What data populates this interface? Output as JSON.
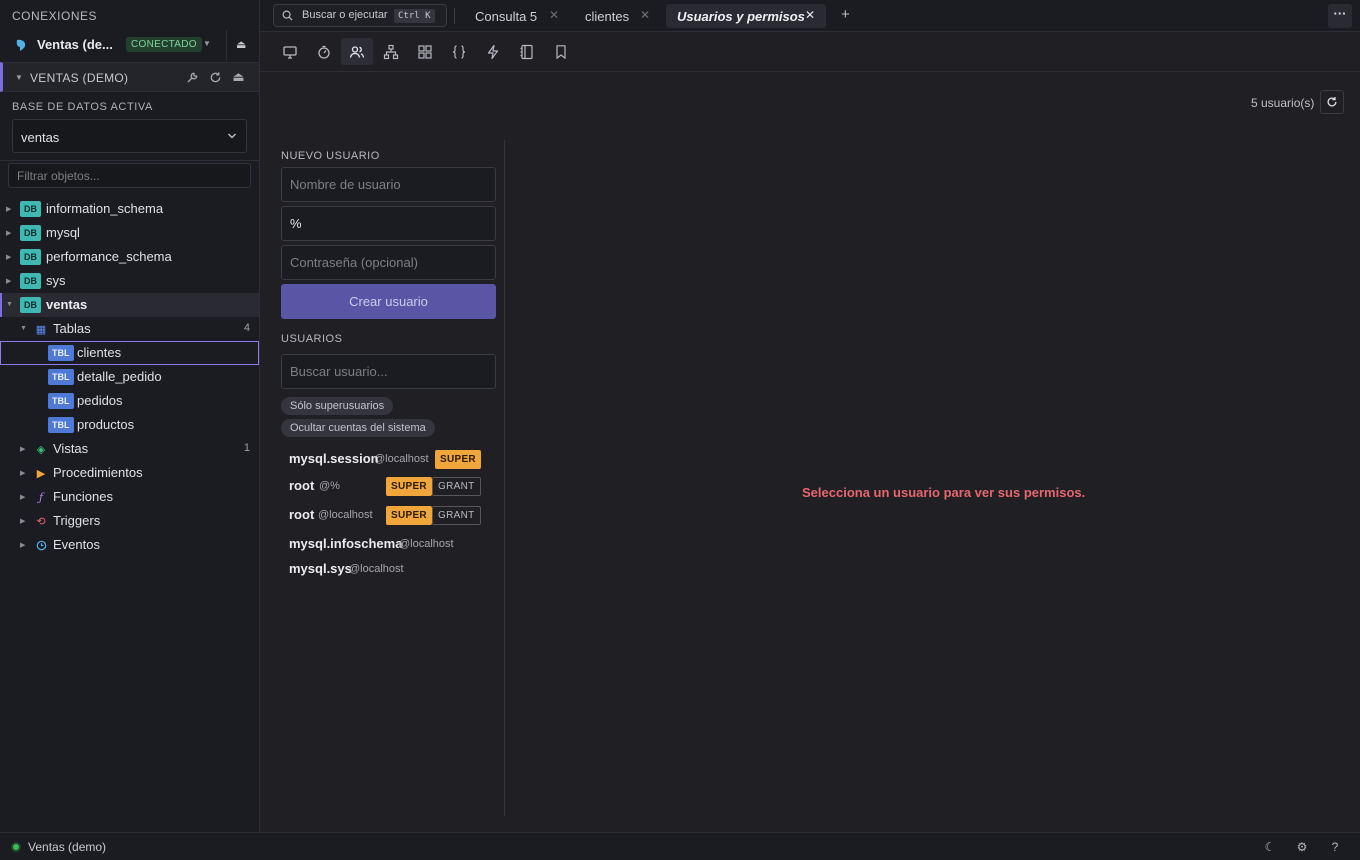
{
  "sidebar": {
    "title": "CONEXIONES",
    "connection": {
      "name": "Ventas (de...",
      "status": "CONECTADO"
    },
    "db_header": {
      "name": "VENTAS (DEMO)"
    },
    "active_db": {
      "label": "BASE DE DATOS ACTIVA",
      "value": "ventas"
    },
    "filter": {
      "placeholder": "Filtrar objetos..."
    },
    "tree": {
      "databases": [
        "information_schema",
        "mysql",
        "performance_schema",
        "sys",
        "ventas"
      ],
      "db_badge": "DB",
      "tbl_badge": "TBL",
      "tablas": {
        "label": "Tablas",
        "count": "4"
      },
      "tables": [
        "clientes",
        "detalle_pedido",
        "pedidos",
        "productos"
      ],
      "vistas": {
        "label": "Vistas",
        "count": "1"
      },
      "procedimientos": "Procedimientos",
      "funciones": "Funciones",
      "triggers": "Triggers",
      "eventos": "Eventos"
    }
  },
  "topbar": {
    "search": {
      "label": "Buscar o ejecutar",
      "shortcut": "Ctrl K"
    },
    "tabs": [
      {
        "label": "Consulta 5",
        "active": false
      },
      {
        "label": "clientes",
        "active": false
      },
      {
        "label": "Usuarios y permisos",
        "active": true
      }
    ],
    "add_tab": "+",
    "more": "···"
  },
  "toolbar": {
    "buttons": [
      "monitor-icon",
      "timer-icon",
      "users-icon",
      "hierarchy-icon",
      "grid-icon",
      "braces-icon",
      "bolt-icon",
      "notebook-icon",
      "bookmark-icon"
    ],
    "active": "users-icon"
  },
  "main": {
    "user_count": "5 usuario(s)",
    "new_user": {
      "label": "NUEVO USUARIO",
      "username_placeholder": "Nombre de usuario",
      "host_value": "%",
      "password_placeholder": "Contraseña (opcional)",
      "create_label": "Crear usuario"
    },
    "users": {
      "label": "USUARIOS",
      "search_placeholder": "Buscar usuario...",
      "filter_super": "Sólo superusuarios",
      "filter_system": "Ocultar cuentas del sistema",
      "super_badge": "SUPER",
      "grant_badge": "GRANT",
      "list": [
        {
          "name": "mysql.session",
          "host": "@localhost",
          "super": true,
          "grant": false
        },
        {
          "name": "root",
          "host": "@%",
          "super": true,
          "grant": true
        },
        {
          "name": "root",
          "host": "@localhost",
          "super": true,
          "grant": true
        },
        {
          "name": "mysql.infoschema",
          "host": "@localhost",
          "super": false,
          "grant": false
        },
        {
          "name": "mysql.sys",
          "host": "@localhost",
          "super": false,
          "grant": false
        }
      ]
    },
    "empty_message": "Selecciona un usuario para ver sus permisos."
  },
  "statusbar": {
    "connection": "Ventas (demo)"
  },
  "colors": {
    "accent": "#7b6ee0",
    "super": "#f0a63a",
    "error": "#e8666e",
    "connected": "#3fb85c"
  }
}
